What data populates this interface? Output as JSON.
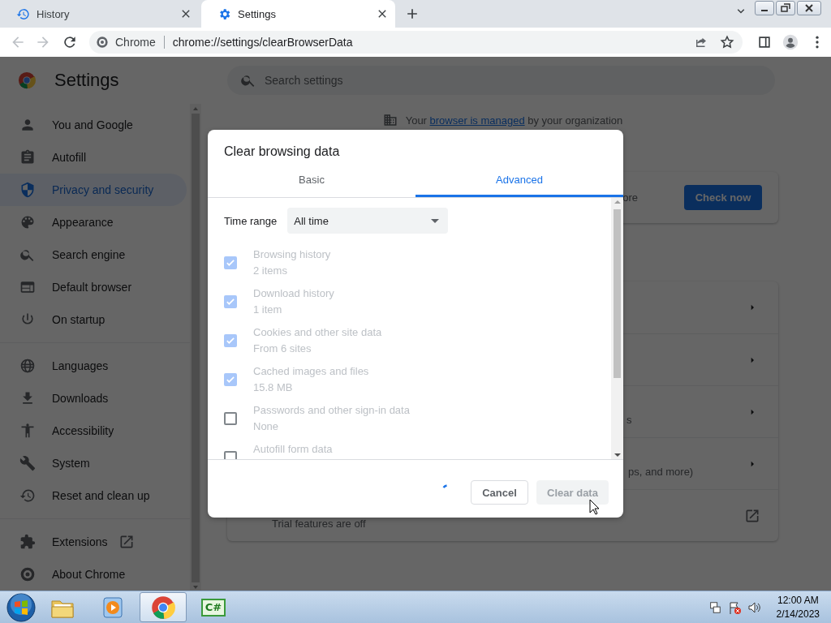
{
  "browser": {
    "tabs": [
      {
        "title": "History",
        "selected": false
      },
      {
        "title": "Settings",
        "selected": true
      }
    ],
    "omnibox": {
      "site_label": "Chrome",
      "url": "chrome://settings/clearBrowserData"
    }
  },
  "settings": {
    "title": "Settings",
    "search_placeholder": "Search settings",
    "sidebar": {
      "groups": [
        {
          "items": [
            {
              "label": "You and Google",
              "selected": false,
              "external": false
            },
            {
              "label": "Autofill",
              "selected": false,
              "external": false
            },
            {
              "label": "Privacy and security",
              "selected": true,
              "external": false
            },
            {
              "label": "Appearance",
              "selected": false,
              "external": false
            },
            {
              "label": "Search engine",
              "selected": false,
              "external": false
            },
            {
              "label": "Default browser",
              "selected": false,
              "external": false
            },
            {
              "label": "On startup",
              "selected": false,
              "external": false
            }
          ]
        },
        {
          "items": [
            {
              "label": "Languages",
              "selected": false,
              "external": false
            },
            {
              "label": "Downloads",
              "selected": false,
              "external": false
            },
            {
              "label": "Accessibility",
              "selected": false,
              "external": false
            },
            {
              "label": "System",
              "selected": false,
              "external": false
            },
            {
              "label": "Reset and clean up",
              "selected": false,
              "external": false
            }
          ]
        },
        {
          "items": [
            {
              "label": "Extensions",
              "selected": false,
              "external": true
            },
            {
              "label": "About Chrome",
              "selected": false,
              "external": false
            }
          ]
        }
      ]
    },
    "managed_notice": {
      "before": "Your",
      "link": "browser is managed",
      "after": "by your organization"
    },
    "safety_card": {
      "cut_text": "ore",
      "button": "Check now"
    },
    "privacy_rows": [
      {
        "kind": "submenu"
      },
      {
        "kind": "submenu"
      },
      {
        "kind": "submenu",
        "cut_text": "s"
      },
      {
        "kind": "submenu",
        "cut_text": "ps, and more)"
      },
      {
        "kind": "external",
        "text": "Trial features are off"
      }
    ]
  },
  "dialog": {
    "title": "Clear browsing data",
    "tabs": [
      {
        "label": "Basic",
        "selected": false
      },
      {
        "label": "Advanced",
        "selected": true
      }
    ],
    "time_range": {
      "label": "Time range",
      "value": "All time"
    },
    "options": [
      {
        "label": "Browsing history",
        "detail": "2 items",
        "checked": true,
        "disabled": true
      },
      {
        "label": "Download history",
        "detail": "1 item",
        "checked": true,
        "disabled": true
      },
      {
        "label": "Cookies and other site data",
        "detail": "From 6 sites",
        "checked": true,
        "disabled": true
      },
      {
        "label": "Cached images and files",
        "detail": "15.8 MB",
        "checked": true,
        "disabled": true
      },
      {
        "label": "Passwords and other sign-in data",
        "detail": "None",
        "checked": false,
        "disabled": true
      },
      {
        "label": "Autofill form data",
        "checked": false,
        "disabled": true
      }
    ],
    "busy": true,
    "buttons": [
      {
        "label": "Cancel",
        "disabled": false
      },
      {
        "label": "Clear data",
        "disabled": true
      }
    ]
  },
  "taskbar": {
    "apps": [
      {
        "selected": false
      },
      {
        "selected": false
      },
      {
        "selected": true
      },
      {
        "selected": false,
        "badge_text": "C#"
      }
    ],
    "clock": {
      "time": "12:00 AM",
      "date": "2/14/2023"
    }
  }
}
